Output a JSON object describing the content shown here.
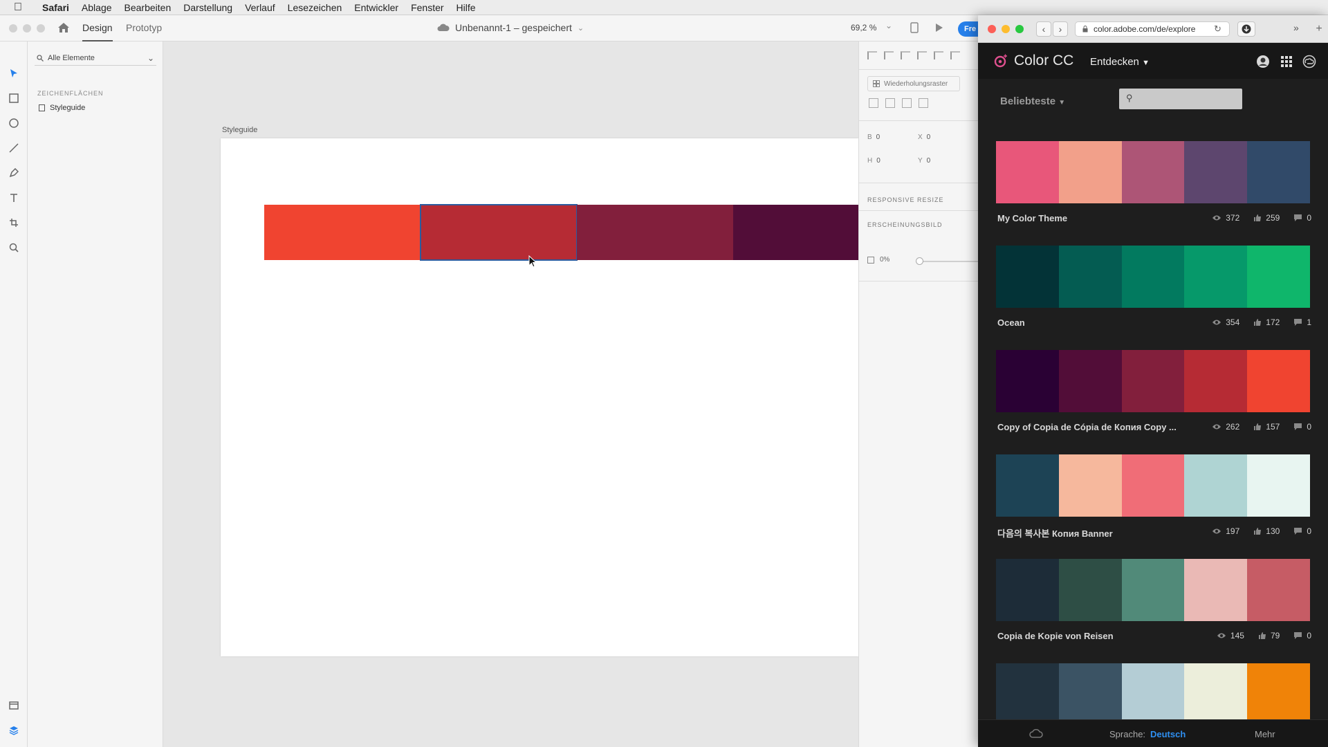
{
  "menubar": {
    "app": "Safari",
    "items": [
      "Ablage",
      "Bearbeiten",
      "Darstellung",
      "Verlauf",
      "Lesezeichen",
      "Entwickler",
      "Fenster",
      "Hilfe"
    ]
  },
  "xd": {
    "tabs": [
      "Design",
      "Prototyp"
    ],
    "doc_title": "Unbenannt-1 – gespeichert",
    "zoom": "69,2 %",
    "share_label": "Fre",
    "layers": {
      "search_label": "Alle Elemente",
      "section": "ZEICHENFLÄCHEN",
      "artboard": "Styleguide"
    },
    "artboard_label": "Styleguide",
    "swatches": [
      "#f04430",
      "#b62b34",
      "#821f3c",
      "#520d38"
    ],
    "props": {
      "repeat_grid": "Wiederholungsraster",
      "w_label": "B",
      "w_value": "0",
      "x_label": "X",
      "x_value": "0",
      "h_label": "H",
      "h_value": "0",
      "y_label": "Y",
      "y_value": "0",
      "responsive_resize": "RESPONSIVE RESIZE",
      "appearance": "ERSCHEINUNGSBILD",
      "opacity": "0%"
    }
  },
  "safari": {
    "url": "color.adobe.com/de/explore",
    "brand": "Color CC",
    "discover": "Entdecken",
    "sort": "Beliebteste",
    "themes": [
      {
        "name": "My Color Theme",
        "views": "372",
        "likes": "259",
        "comments": "0",
        "colors": [
          "#e8577a",
          "#f2a08a",
          "#ad5576",
          "#5d466e",
          "#314a69"
        ]
      },
      {
        "name": "Ocean",
        "views": "354",
        "likes": "172",
        "comments": "1",
        "colors": [
          "#033337",
          "#045c52",
          "#027a5f",
          "#06996a",
          "#0fb66b"
        ]
      },
      {
        "name": "Copy of Copia de Cópia de Копия Copy ...",
        "views": "262",
        "likes": "157",
        "comments": "0",
        "colors": [
          "#2a0134",
          "#520d38",
          "#821f3c",
          "#b62b34",
          "#f04430"
        ]
      },
      {
        "name": "다음의 복사본 Копия Banner",
        "views": "197",
        "likes": "130",
        "comments": "0",
        "colors": [
          "#1d4355",
          "#f6b89d",
          "#f06d77",
          "#afd4d3",
          "#e8f5f1"
        ]
      },
      {
        "name": "Copia de Kopie von Reisen",
        "views": "145",
        "likes": "79",
        "comments": "0",
        "colors": [
          "#1d2c38",
          "#2e4e45",
          "#518a79",
          "#eab9b5",
          "#c65c65"
        ]
      },
      {
        "name": "",
        "views": "",
        "likes": "",
        "comments": "",
        "colors": [
          "#22323e",
          "#3b5364",
          "#b4cdd5",
          "#eceedb",
          "#f08308"
        ]
      }
    ],
    "footer": {
      "lang_label": "Sprache:",
      "lang_value": "Deutsch",
      "more": "Mehr"
    }
  }
}
